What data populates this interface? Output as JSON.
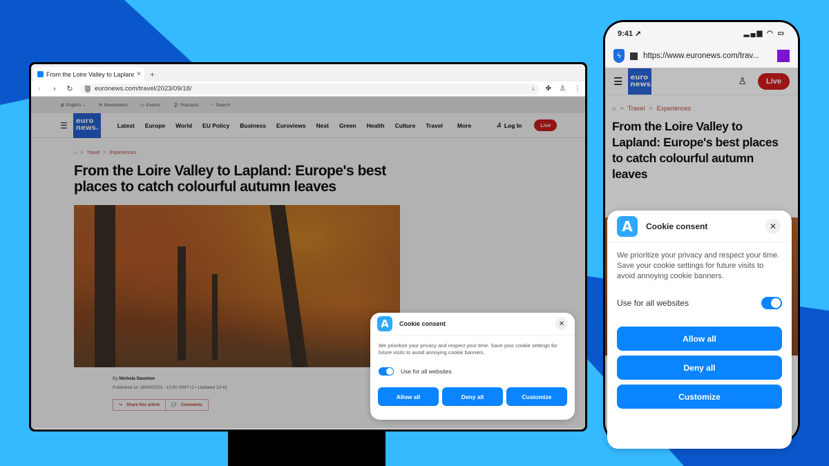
{
  "colors": {
    "accent": "#0a84ff",
    "brand_blue": "#2a64d6",
    "live_red": "#d11e1e",
    "crumb": "#b5483c",
    "bg_light": "#35b9ff",
    "bg_dark": "#0a57cc",
    "extension_purple": "#7a15d4"
  },
  "desktop": {
    "tab": {
      "title": "From the Loire Valley to Lapland: Europe's best places to catch colourful autumn leaves",
      "close_icon": "×",
      "new_tab_icon": "+"
    },
    "address": {
      "url": "euronews.com/travel/2023/09/18/"
    },
    "icons": {
      "back": "‹",
      "forward": "›",
      "reload": "↻",
      "extension": "✤",
      "profile": "♙",
      "menu": "⋮",
      "download": "⤓"
    },
    "utility": [
      "English ⌄",
      "Newsletters",
      "Events",
      "Podcasts",
      "Search"
    ],
    "utility_icons": [
      "◍",
      "✉",
      "▭",
      "🎙",
      "⌕"
    ],
    "logo": {
      "line1": "euro",
      "line2": "news."
    },
    "nav": [
      "Latest",
      "Europe",
      "World",
      "EU Policy",
      "Business",
      "Euroviews",
      "Next",
      "Green",
      "Health",
      "Culture",
      "Travel",
      "More"
    ],
    "login": "Log In",
    "live": "Live",
    "breadcrumb": {
      "home_icon": "⌂",
      "sep": ">",
      "items": [
        "Travel",
        "Experiences"
      ]
    },
    "headline": "From the Loire Valley to Lapland: Europe's best places to catch colourful autumn leaves",
    "byline_prefix": "By ",
    "author": "Nichola Daunton",
    "published": "Published on 18/09/2023 - 10:00 GMT+2  •  Updated 10:41",
    "actions": {
      "share": "Share this article",
      "comments": "Comments",
      "share_icon": "↪",
      "comments_icon": "💬"
    }
  },
  "mobile": {
    "time": "9:41 ➚",
    "status_icons": "▂▄▆ ◠ ▭",
    "url": "https://www.euronews.com/trav...",
    "logo": {
      "line1": "euro",
      "line2": "news."
    },
    "live": "Live",
    "user_icon": "♙",
    "breadcrumb": {
      "home_icon": "⌂",
      "sep": ">",
      "items": [
        "Travel",
        "Experiences"
      ]
    },
    "headline": "From the Loire Valley to Lapland: Europe's best places to catch colourful autumn leaves"
  },
  "cookie": {
    "logo_glyph": "A",
    "title": "Cookie consent",
    "close_icon": "✕",
    "body": "We prioritize your privacy and respect your time. Save your cookie settings for future visits to avoid annoying cookie banners.",
    "toggle_label": "Use for all websites",
    "toggle_on": true,
    "buttons": {
      "allow": "Allow all",
      "deny": "Deny all",
      "customize": "Customize"
    }
  }
}
